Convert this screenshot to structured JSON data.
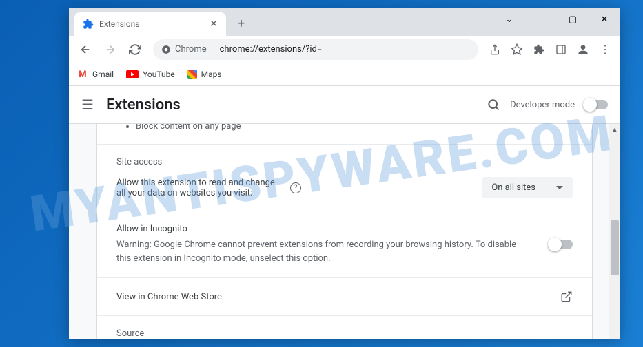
{
  "watermark": "MYANTISPYWARE.COM",
  "tab": {
    "title": "Extensions"
  },
  "address": {
    "chip": "Chrome",
    "path": "chrome://extensions/?id="
  },
  "bookmarks": {
    "gmail": "Gmail",
    "youtube": "YouTube",
    "maps": "Maps"
  },
  "subheader": {
    "title": "Extensions",
    "dev_mode": "Developer mode"
  },
  "panel": {
    "bullet": "Block content on any page",
    "site_access_label": "Site access",
    "site_access_text": "Allow this extension to read and change all your data on websites you visit:",
    "site_access_value": "On all sites",
    "incognito_title": "Allow in Incognito",
    "incognito_warning": "Warning: Google Chrome cannot prevent extensions from recording your browsing history. To disable this extension in Incognito mode, unselect this option.",
    "view_store": "View in Chrome Web Store",
    "source_label": "Source"
  }
}
